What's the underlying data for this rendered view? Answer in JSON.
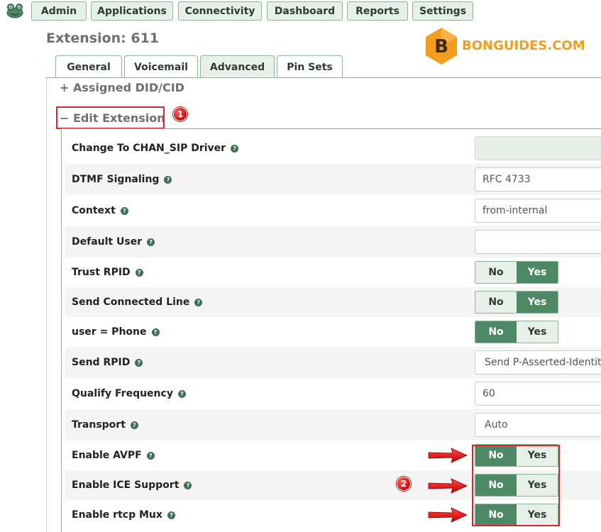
{
  "nav": {
    "items": [
      "Admin",
      "Applications",
      "Connectivity",
      "Dashboard",
      "Reports",
      "Settings"
    ]
  },
  "page_title": "Extension: 611",
  "watermark": {
    "text": "BONGUIDES.COM",
    "letter": "B"
  },
  "tabs": [
    "General",
    "Voicemail",
    "Advanced",
    "Pin Sets"
  ],
  "active_tab": "Advanced",
  "sections": {
    "assigned": {
      "symbol": "+",
      "label": "Assigned DID/CID"
    },
    "edit": {
      "symbol": "−",
      "label": "Edit Extension"
    }
  },
  "badges": [
    "1",
    "2"
  ],
  "toggle_labels": {
    "no": "No",
    "yes": "Yes"
  },
  "fields": [
    {
      "label": "Change To CHAN_SIP Driver",
      "value": ""
    },
    {
      "label": "DTMF Signaling",
      "value": "RFC 4733"
    },
    {
      "label": "Context",
      "value": "from-internal"
    },
    {
      "label": "Default User",
      "value": ""
    },
    {
      "label": "Trust RPID",
      "selected": "Yes"
    },
    {
      "label": "Send Connected Line",
      "selected": "Yes"
    },
    {
      "label": "user = Phone",
      "selected": "No"
    },
    {
      "label": "Send RPID",
      "value": "Send P-Asserted-Identity header"
    },
    {
      "label": "Qualify Frequency",
      "value": "60"
    },
    {
      "label": "Transport",
      "value": "Auto"
    },
    {
      "label": "Enable AVPF",
      "selected": "No"
    },
    {
      "label": "Enable ICE Support",
      "selected": "No"
    },
    {
      "label": "Enable rtcp Mux",
      "selected": "No"
    }
  ],
  "colors": {
    "accent": "#4d8965",
    "highlight": "#d9252b",
    "watermark": "#f39c1f"
  }
}
